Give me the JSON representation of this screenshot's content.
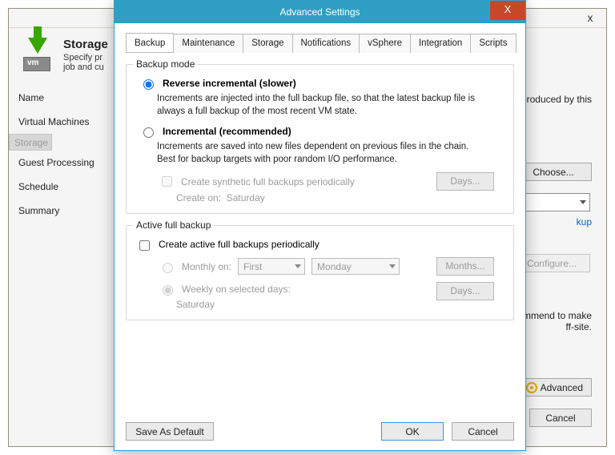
{
  "wizard": {
    "title": "Storage",
    "subtitle_partial": "Specify pr",
    "subtitle2_partial": "job and cu",
    "subtitle_tail": "files produced by this",
    "nav": [
      "Name",
      "Virtual Machines",
      "Storage",
      "Guest Processing",
      "Schedule",
      "Summary"
    ],
    "nav_selected_index": 2,
    "choose_label": "Choose...",
    "configure_label": "Configure...",
    "advanced_label": "Advanced",
    "cancel_label": "Cancel",
    "link_tail": "kup",
    "body_tail1": "ecommend to make",
    "body_tail2": "ff-site.",
    "close_glyph": "x"
  },
  "advanced": {
    "title": "Advanced Settings",
    "close_glyph": "X",
    "tabs": [
      "Backup",
      "Maintenance",
      "Storage",
      "Notifications",
      "vSphere",
      "Integration",
      "Scripts"
    ],
    "active_tab_index": 0,
    "backup_mode": {
      "legend": "Backup mode",
      "reverse": {
        "label": "Reverse incremental (slower)",
        "desc": "Increments are injected into the full backup file, so that the latest backup file is always a full backup of the most recent VM state.",
        "checked": true
      },
      "incremental": {
        "label": "Incremental (recommended)",
        "desc": "Increments are saved into new files dependent on previous files in the chain. Best for backup targets with poor random I/O performance.",
        "checked": false
      },
      "synthetic": {
        "label": "Create synthetic full backups periodically",
        "checked": false,
        "days_btn": "Days...",
        "create_on_label": "Create on:",
        "create_on_value": "Saturday"
      }
    },
    "active_full": {
      "legend": "Active full backup",
      "create_label": "Create active full backups periodically",
      "create_checked": false,
      "monthly": {
        "label": "Monthly on:",
        "ord": "First",
        "day": "Monday",
        "btn": "Months...",
        "checked": false
      },
      "weekly": {
        "label": "Weekly on selected days:",
        "btn": "Days...",
        "value": "Saturday",
        "checked": true
      }
    },
    "footer": {
      "save": "Save As Default",
      "ok": "OK",
      "cancel": "Cancel"
    }
  }
}
